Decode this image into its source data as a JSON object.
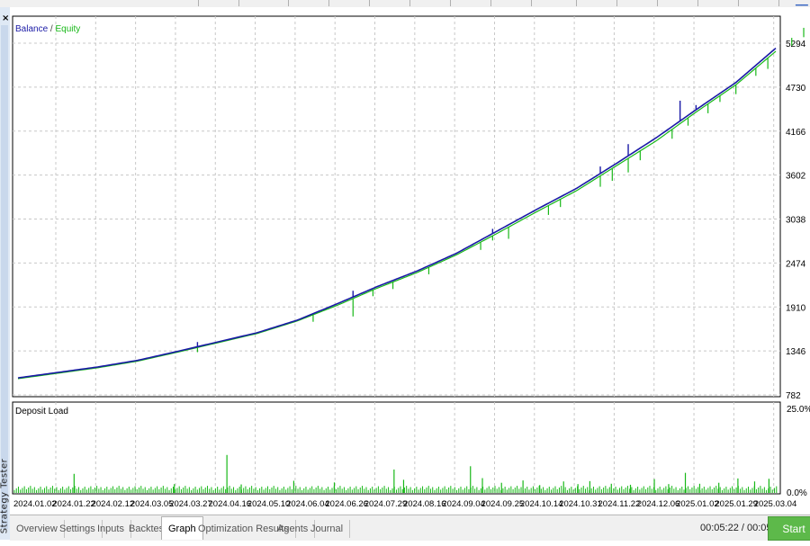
{
  "side_panel": {
    "title": "Strategy Tester",
    "close_label": "×"
  },
  "chart_data": [
    {
      "type": "line",
      "legend": {
        "balance_label": "Balance",
        "separator": " / ",
        "equity_label": "Equity",
        "placement": "top-left"
      },
      "series": [
        {
          "name": "Balance",
          "color": "#1a1aa6"
        },
        {
          "name": "Equity",
          "color": "#18b818"
        }
      ],
      "x_tick_labels": [
        "2024.01.02",
        "2024.01.22",
        "2024.02.12",
        "2024.03.05",
        "2024.03.27",
        "2024.04.16",
        "2024.05.10",
        "2024.06.04",
        "2024.06.26",
        "2024.07.29",
        "2024.08.16",
        "2024.09.04",
        "2024.09.25",
        "2024.10.14",
        "2024.10.31",
        "2024.11.22",
        "2024.12.06",
        "2025.01.02",
        "2025.01.29",
        "2025.03.04"
      ],
      "y_tick_labels": [
        "5294",
        "4730",
        "4166",
        "3602",
        "3038",
        "2474",
        "1910",
        "1346",
        "782"
      ],
      "ylim": [
        782,
        5294
      ],
      "x": [
        0,
        1,
        2,
        3,
        4,
        5,
        6,
        7,
        8,
        9,
        10,
        11,
        12,
        13,
        14,
        15,
        16,
        17,
        18,
        19
      ],
      "balance": [
        1000,
        1070,
        1140,
        1225,
        1340,
        1460,
        1580,
        1740,
        1950,
        2170,
        2370,
        2600,
        2880,
        3160,
        3430,
        3750,
        4080,
        4440,
        4790,
        5230
      ],
      "equity": [
        990,
        1060,
        1130,
        1215,
        1330,
        1450,
        1570,
        1730,
        1930,
        2150,
        2350,
        2580,
        2850,
        3130,
        3400,
        3720,
        4040,
        4410,
        4760,
        5190
      ],
      "grid": true
    },
    {
      "type": "bar",
      "title": "Deposit Load",
      "y_tick_labels": [
        "25.0%",
        "0.0%"
      ],
      "ylim": [
        0,
        25
      ],
      "color": "#18b818",
      "peaks": [
        {
          "x": 2.5,
          "value": 5.5
        },
        {
          "x": 6.7,
          "value": 2.4
        },
        {
          "x": 8.9,
          "value": 11.2
        },
        {
          "x": 9.5,
          "value": 2.3
        },
        {
          "x": 11.7,
          "value": 3.4
        },
        {
          "x": 13.4,
          "value": 2.9
        },
        {
          "x": 15.9,
          "value": 6.8
        },
        {
          "x": 16.3,
          "value": 3.7
        },
        {
          "x": 19.1,
          "value": 7.8
        },
        {
          "x": 19.6,
          "value": 4.2
        },
        {
          "x": 20.4,
          "value": 2.8
        },
        {
          "x": 21.3,
          "value": 3.5
        },
        {
          "x": 22.0,
          "value": 2.1
        },
        {
          "x": 23.0,
          "value": 3.2
        },
        {
          "x": 23.6,
          "value": 2.4
        },
        {
          "x": 24.1,
          "value": 3.3
        },
        {
          "x": 25.0,
          "value": 2.5
        },
        {
          "x": 25.8,
          "value": 2.2
        },
        {
          "x": 26.8,
          "value": 3.9
        },
        {
          "x": 27.4,
          "value": 2.4
        },
        {
          "x": 28.1,
          "value": 5.8
        },
        {
          "x": 28.7,
          "value": 2.5
        },
        {
          "x": 29.5,
          "value": 2.8
        },
        {
          "x": 30.3,
          "value": 4.1
        },
        {
          "x": 31.0,
          "value": 3.2
        },
        {
          "x": 31.6,
          "value": 4.0
        }
      ]
    }
  ],
  "tabs": [
    {
      "label": "Overview",
      "active": false
    },
    {
      "label": "Settings",
      "active": false
    },
    {
      "label": "Inputs",
      "active": false
    },
    {
      "label": "Backtest",
      "active": false
    },
    {
      "label": "Graph",
      "active": true
    },
    {
      "label": "Optimization Results",
      "active": false
    },
    {
      "label": "Agents",
      "active": false
    },
    {
      "label": "Journal",
      "active": false
    }
  ],
  "status": {
    "timer": "00:05:22 / 00:05:22"
  },
  "start_button": {
    "label": "Start",
    "color": "#5db94a"
  }
}
